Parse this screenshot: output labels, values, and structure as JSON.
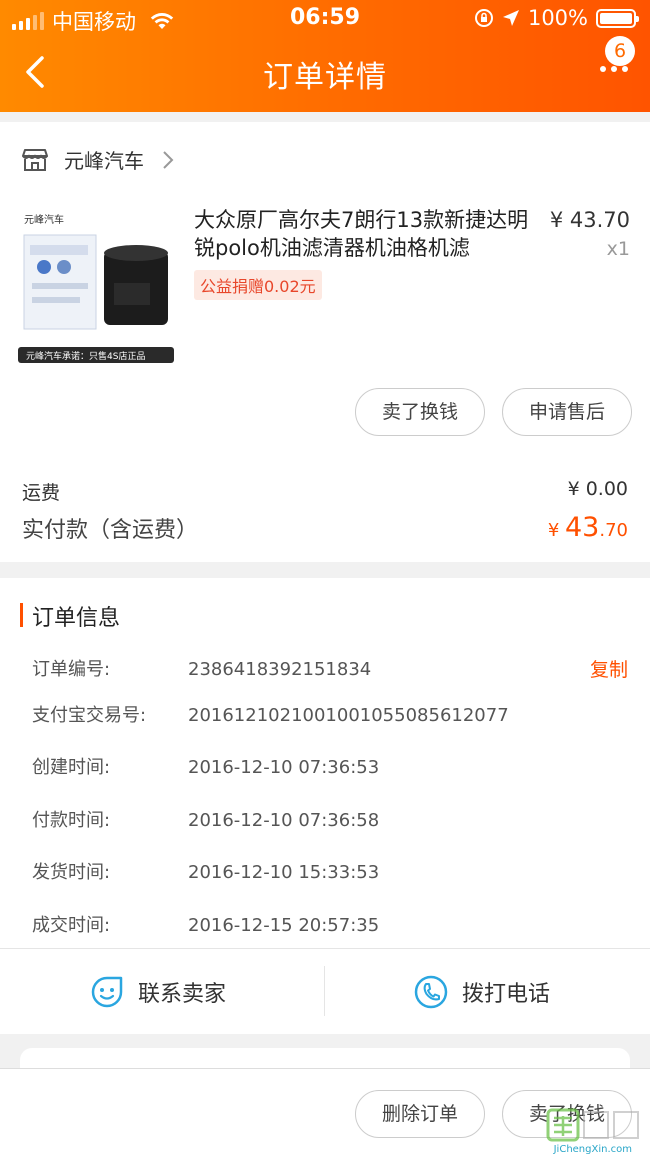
{
  "status_bar": {
    "carrier": "中国移动",
    "time": "06:59",
    "battery": "100%"
  },
  "nav": {
    "title": "订单详情",
    "more_badge": "6"
  },
  "store": {
    "name": "元峰汽车"
  },
  "product": {
    "title": "大众原厂高尔夫7朗行13款新捷达明锐polo机油滤清器机油格机滤",
    "price": "¥ 43.70",
    "qty": "x1",
    "charity": "公益捐赠0.02元",
    "thumb_banner": "元峰汽车承诺：只售4S店正品",
    "thumb_brand": "元峰汽车"
  },
  "item_actions": {
    "sell": "卖了换钱",
    "after_sale": "申请售后"
  },
  "fees": {
    "shipping_label": "运费",
    "shipping_value": "¥ 0.00",
    "paid_label": "实付款（含运费）",
    "paid_currency": "¥",
    "paid_int": "43",
    "paid_dec": ".70"
  },
  "order_info": {
    "title": "订单信息",
    "copy_label": "复制",
    "rows": [
      {
        "k": "订单编号:",
        "v": "2386418392151834"
      },
      {
        "k": "支付宝交易号:",
        "v": "2016121021001001055085612077"
      },
      {
        "k": "创建时间:",
        "v": "2016-12-10 07:36:53"
      },
      {
        "k": "付款时间:",
        "v": "2016-12-10 07:36:58"
      },
      {
        "k": "发货时间:",
        "v": "2016-12-10 15:33:53"
      },
      {
        "k": "成交时间:",
        "v": "2016-12-15 20:57:35"
      }
    ]
  },
  "contact": {
    "seller": "联系卖家",
    "call": "拨打电话"
  },
  "bottom_bar": {
    "delete": "删除订单",
    "sell": "卖了换钱"
  },
  "watermark": {
    "text": "JiChengXin.com"
  },
  "colors": {
    "accent": "#ff5000",
    "header_from": "#ff8a00",
    "header_to": "#ff5400",
    "link_blue": "#2aa6e0"
  }
}
